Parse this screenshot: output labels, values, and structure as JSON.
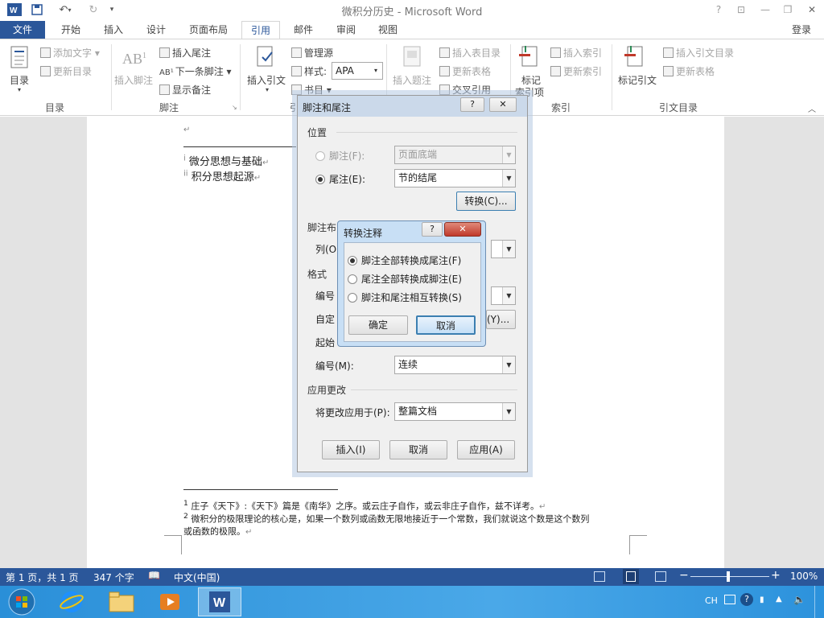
{
  "window": {
    "title": "微积分历史 - Microsoft Word",
    "controls": [
      "?",
      "⊡",
      "—",
      "❐",
      "✕"
    ]
  },
  "tabs": {
    "file": "文件",
    "items": [
      "开始",
      "插入",
      "设计",
      "页面布局",
      "引用",
      "邮件",
      "审阅",
      "视图"
    ],
    "active": "引用",
    "login": "登录"
  },
  "ribbon": {
    "toc": {
      "big": "目录",
      "add_text": "添加文字",
      "update": "更新目录",
      "group": "目录"
    },
    "footnotes": {
      "insert_footnote": "插入脚注",
      "insert_endnote": "插入尾注",
      "next_footnote": "下一条脚注",
      "show_notes": "显示备注",
      "group": "脚注"
    },
    "citations": {
      "insert_citation": "插入引文",
      "manage_sources": "管理源",
      "style_label": "样式:",
      "style_value": "APA",
      "bibliography": "书目",
      "group": "引"
    },
    "captions": {
      "insert_caption": "插入题注",
      "insert_table_figures": "插入表目录",
      "update_table": "更新表格",
      "cross_reference": "交叉引用"
    },
    "index": {
      "mark_entry_1": "标记",
      "mark_entry_2": "索引项",
      "insert_index": "插入索引",
      "update_index": "更新索引",
      "group": "索引"
    },
    "authorities": {
      "mark_citation": "标记引文",
      "insert_table": "插入引文目录",
      "update_table": "更新表格",
      "group": "引文目录"
    }
  },
  "document": {
    "lines": [
      "微分思想与基础",
      "积分思想起源"
    ],
    "footnotes": [
      "庄子《天下》:《天下》篇是《南华》之序。或云庄子自作，或云非庄子自作，兹不详考。",
      "微积分的极限理论的核心是，如果一个数列或函数无限地接近于一个常数，我们就说这个数是这个数列",
      "或函数的极限。"
    ]
  },
  "dialog_notes": {
    "title": "脚注和尾注",
    "position_section": "位置",
    "footnote_label": "脚注(F):",
    "footnote_value": "页面底端",
    "endnote_label": "尾注(E):",
    "endnote_value": "节的结尾",
    "convert_button": "转换(C)...",
    "layout_section": "脚注布",
    "columns_label": "列(O",
    "format_section": "格式",
    "number_format_label": "编号",
    "custom_mark_label": "自定",
    "symbol_button_tail": "(Y)...",
    "start_at_label": "起始",
    "numbering_label": "编号(M):",
    "numbering_value": "连续",
    "apply_section": "应用更改",
    "apply_to_label": "将更改应用于(P):",
    "apply_to_value": "整篇文档",
    "insert_button": "插入(I)",
    "cancel_button": "取消",
    "apply_button": "应用(A)"
  },
  "dialog_convert": {
    "title": "转换注释",
    "options": [
      "脚注全部转换成尾注(F)",
      "尾注全部转换成脚注(E)",
      "脚注和尾注相互转换(S)"
    ],
    "selected_index": 0,
    "ok_button": "确定",
    "cancel_button": "取消"
  },
  "statusbar": {
    "page": "第 1 页，共 1 页",
    "words": "347 个字",
    "language": "中文(中国)",
    "zoom": "100%"
  },
  "taskbar": {
    "lang": "CH"
  }
}
